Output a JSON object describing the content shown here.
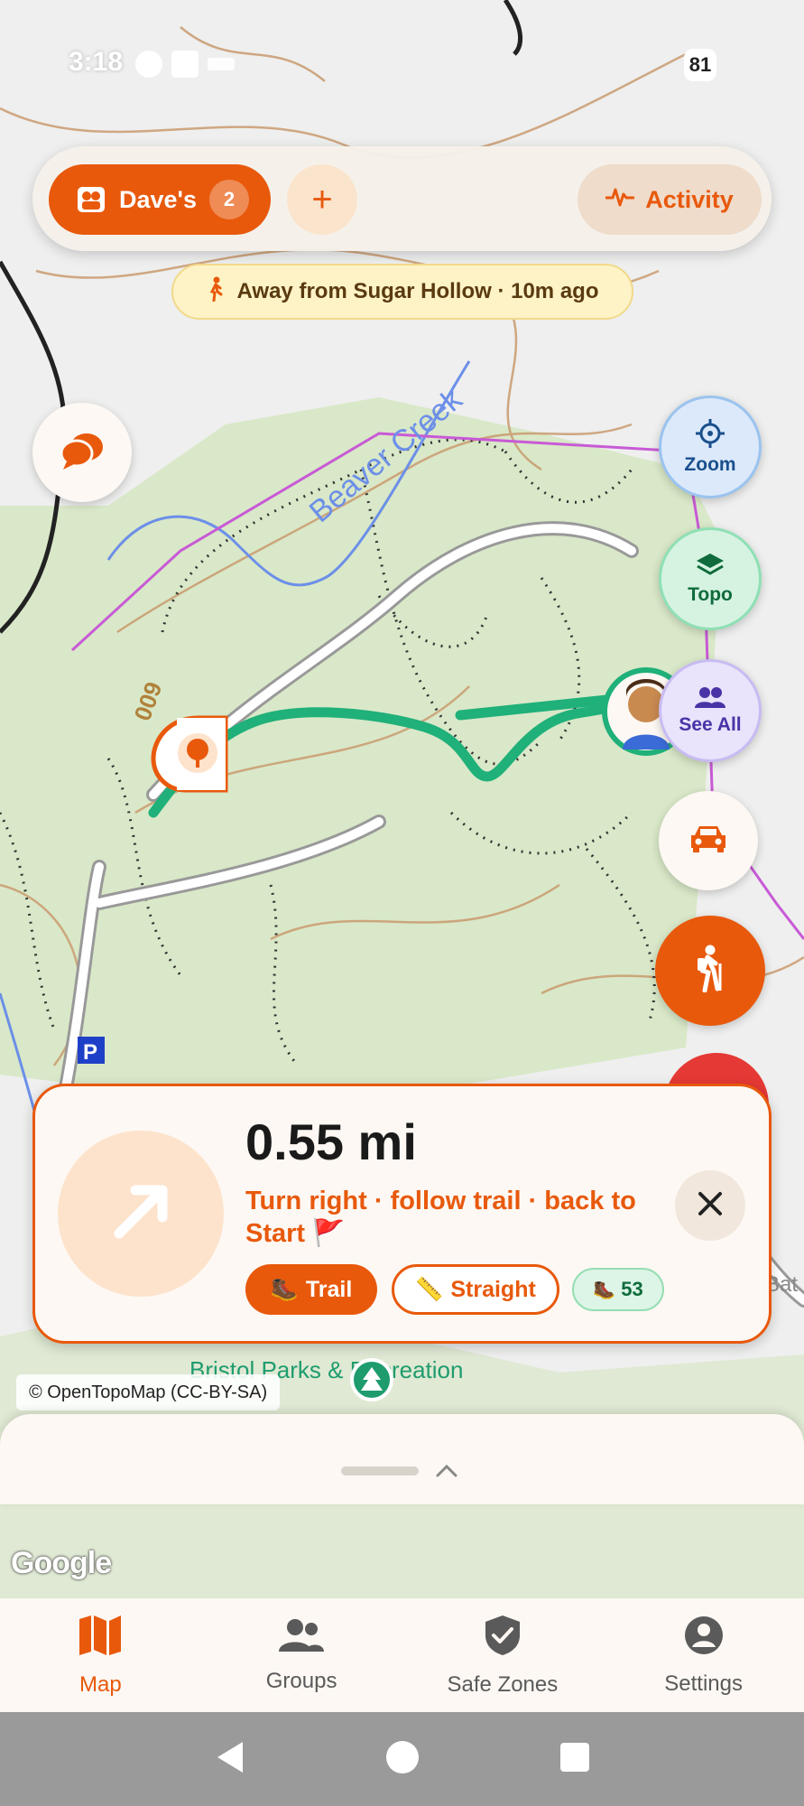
{
  "status_bar": {
    "time": "3:18",
    "battery": "81"
  },
  "top_bar": {
    "group_name": "Dave's",
    "group_count": "2",
    "add_label": "+",
    "activity_label": "Activity"
  },
  "away_banner": {
    "text": "Away from Sugar Hollow · 10m ago"
  },
  "map_labels": {
    "creek": "Beaver Creek",
    "trail_number": "009",
    "parking": "P",
    "park": "Bristol Parks & Recreation",
    "edge": "Bat Loo"
  },
  "side_buttons": {
    "zoom": "Zoom",
    "topo": "Topo",
    "see_all": "See All"
  },
  "navigation_card": {
    "distance": "0.55 mi",
    "instruction": "Turn right · follow trail · back to Start 🚩",
    "mode_trail": "Trail",
    "mode_straight": "Straight",
    "steps": "53"
  },
  "attribution": "© OpenTopoMap (CC-BY-SA)",
  "google_logo": "Google",
  "tabs": [
    {
      "label": "Map",
      "icon": "map-icon",
      "active": true
    },
    {
      "label": "Groups",
      "icon": "groups-icon",
      "active": false
    },
    {
      "label": "Safe Zones",
      "icon": "shield-check-icon",
      "active": false
    },
    {
      "label": "Settings",
      "icon": "account-circle-icon",
      "active": false
    }
  ],
  "colors": {
    "accent": "#e8590c",
    "track": "#20b07a",
    "map_green": "#d9e8c8",
    "boundary": "#c85ad6"
  }
}
